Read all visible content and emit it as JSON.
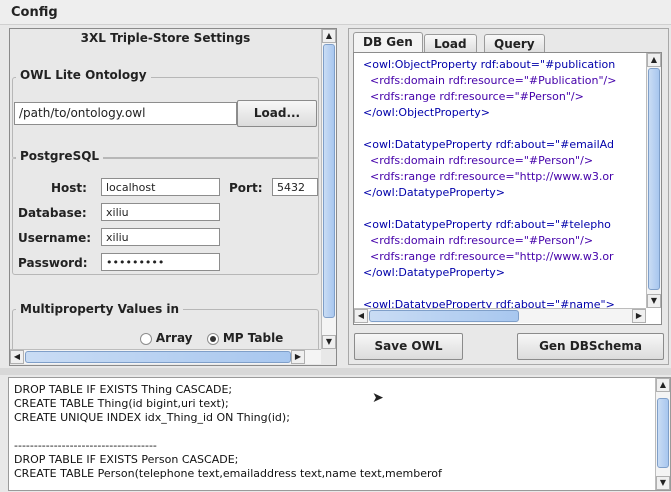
{
  "menu": {
    "config": "Config"
  },
  "settings": {
    "title": "3XL Triple-Store Settings",
    "ontology": {
      "section": "OWL Lite Ontology",
      "path": "/path/to/ontology.owl",
      "load_button": "Load..."
    },
    "postgres": {
      "section": "PostgreSQL",
      "host_label": "Host:",
      "host": "localhost",
      "port_label": "Port:",
      "port": "5432",
      "database_label": "Database:",
      "database": "xiliu",
      "username_label": "Username:",
      "username": "xiliu",
      "password_label": "Password:",
      "password": "•••••••••"
    },
    "multiproperty": {
      "section": "Multiproperty Values in",
      "array": "Array",
      "mp_table": "MP Table",
      "selected": "MP Table"
    }
  },
  "tabs": [
    {
      "label": "DB Gen"
    },
    {
      "label": "Load"
    },
    {
      "label": "Query"
    }
  ],
  "xml_lines": [
    "<owl:ObjectProperty rdf:about=\"#publication",
    "  <rdfs:domain rdf:resource=\"#Publication\"/>",
    "  <rdfs:range rdf:resource=\"#Person\"/>",
    "</owl:ObjectProperty>",
    "",
    "<owl:DatatypeProperty rdf:about=\"#emailAd",
    "  <rdfs:domain rdf:resource=\"#Person\"/>",
    "  <rdfs:range rdf:resource=\"http://www.w3.or",
    "</owl:DatatypeProperty>",
    "",
    "<owl:DatatypeProperty rdf:about=\"#telepho",
    "  <rdfs:domain rdf:resource=\"#Person\"/>",
    "  <rdfs:range rdf:resource=\"http://www.w3.or",
    "</owl:DatatypeProperty>",
    "",
    "<owl:DatatypeProperty rdf:about=\"#name\">"
  ],
  "buttons": {
    "save_owl": "Save OWL",
    "gen_dbschema": "Gen DBSchema"
  },
  "sql_lines": [
    "DROP TABLE IF EXISTS Thing CASCADE;",
    "CREATE TABLE Thing(id bigint,uri text);",
    "CREATE UNIQUE INDEX idx_Thing_id ON Thing(id);",
    "",
    "------------------------------------",
    "DROP TABLE IF EXISTS Person CASCADE;",
    "CREATE TABLE Person(telephone text,emailaddress text,name text,memberof"
  ],
  "icons": {
    "scroll_up": "scroll-up-arrow-icon",
    "scroll_down": "scroll-down-arrow-icon",
    "mouse_cursor": "mouse-pointer-icon"
  }
}
